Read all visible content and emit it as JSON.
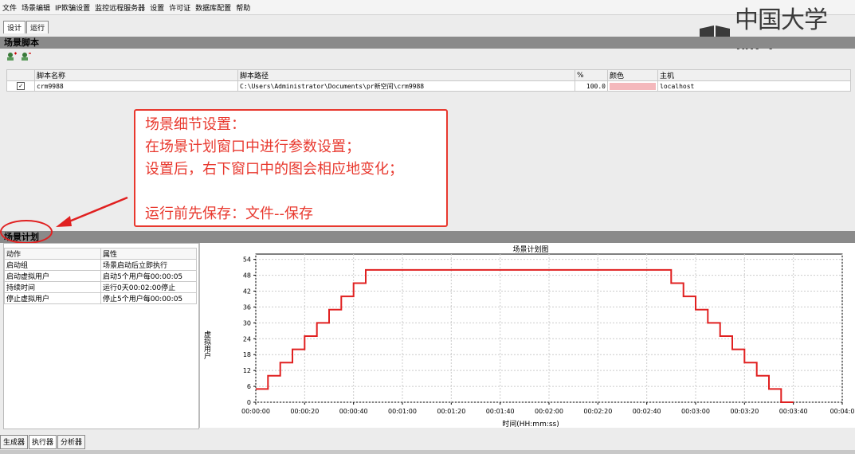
{
  "menu": [
    "文件",
    "场景编辑",
    "IP欺骗设置",
    "监控远程服务器",
    "设置",
    "许可证",
    "数据库配置",
    "帮助"
  ],
  "tabs": [
    "设计",
    "运行"
  ],
  "watermark": "中国大学MO",
  "script_section": {
    "title": "场景脚本",
    "columns": [
      "",
      "脚本名称",
      "脚本路径",
      "%",
      "颜色",
      "主机"
    ],
    "rows": [
      {
        "checked": true,
        "name": "crm9988",
        "path": "C:\\Users\\Administrator\\Documents\\pr新空间\\crm9988",
        "percent": "100.0",
        "color": "#f4b8bc",
        "host": "localhost"
      }
    ]
  },
  "callout": {
    "lines": [
      "场景细节设置：",
      "在场景计划窗口中进行参数设置；",
      "设置后，右下窗口中的图会相应地变化；",
      "",
      "运行前先保存：文件--保存"
    ]
  },
  "plan_section": {
    "title": "场景计划",
    "columns": [
      "动作",
      "属性"
    ],
    "rows": [
      [
        "启动组",
        "场景启动后立即执行"
      ],
      [
        "启动虚拟用户",
        "启动5个用户每00:00:05"
      ],
      [
        "持续时间",
        "运行0天00:02:00停止"
      ],
      [
        "停止虚拟用户",
        "停止5个用户每00:00:05"
      ]
    ]
  },
  "chart_data": {
    "type": "line",
    "title": "场景计划图",
    "xlabel": "时间(HH:mm:ss)",
    "ylabel": "虚拟用户",
    "x_ticks": [
      "00:00:00",
      "00:00:20",
      "00:00:40",
      "00:01:00",
      "00:01:20",
      "00:01:40",
      "00:02:00",
      "00:02:20",
      "00:02:40",
      "00:03:00",
      "00:03:20",
      "00:03:40",
      "00:04:0"
    ],
    "y_ticks": [
      0,
      6,
      12,
      18,
      24,
      30,
      36,
      42,
      48,
      54
    ],
    "xlim": [
      0,
      240
    ],
    "ylim": [
      0,
      56
    ],
    "grid": true,
    "color": "#e02020",
    "x": [
      0,
      5,
      5,
      10,
      10,
      15,
      15,
      20,
      20,
      25,
      25,
      30,
      30,
      35,
      35,
      40,
      40,
      45,
      45,
      50,
      50,
      170,
      170,
      175,
      175,
      180,
      180,
      185,
      185,
      190,
      190,
      195,
      195,
      200,
      200,
      205,
      205,
      210,
      210,
      215,
      215,
      220
    ],
    "y": [
      5,
      5,
      10,
      10,
      15,
      15,
      20,
      20,
      25,
      25,
      30,
      30,
      35,
      35,
      40,
      40,
      45,
      45,
      50,
      50,
      50,
      50,
      45,
      45,
      40,
      40,
      35,
      35,
      30,
      30,
      25,
      25,
      20,
      20,
      15,
      15,
      10,
      10,
      5,
      5,
      0,
      0
    ]
  },
  "bottom_tabs": [
    "生成器",
    "执行器",
    "分析器"
  ]
}
